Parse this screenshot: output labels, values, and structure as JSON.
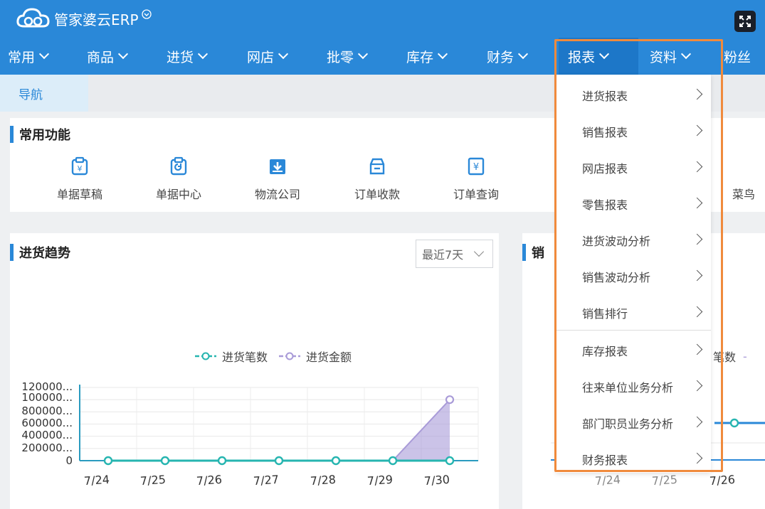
{
  "app": {
    "brand": "管家婆云ERP"
  },
  "nav": [
    {
      "label": "常用"
    },
    {
      "label": "商品"
    },
    {
      "label": "进货"
    },
    {
      "label": "网店"
    },
    {
      "label": "批零"
    },
    {
      "label": "库存"
    },
    {
      "label": "财务"
    },
    {
      "label": "报表"
    },
    {
      "label": "资料"
    },
    {
      "label": "粉丝"
    }
  ],
  "tabs": {
    "nav_tab": "导航"
  },
  "common": {
    "title": "常用功能",
    "items": [
      {
        "label": "单据草稿",
        "icon": "draft-document-icon"
      },
      {
        "label": "单据中心",
        "icon": "document-center-icon"
      },
      {
        "label": "物流公司",
        "icon": "logistics-icon"
      },
      {
        "label": "订单收款",
        "icon": "order-payment-icon"
      },
      {
        "label": "订单查询",
        "icon": "order-query-icon"
      },
      {
        "label": "菜鸟",
        "icon": "cainiao-icon"
      }
    ]
  },
  "purchase_trend": {
    "title": "进货趋势",
    "range_select": "最近7天"
  },
  "sales_panel": {
    "title_partial": "销",
    "legend_partial": "笔数"
  },
  "report_menu": {
    "items": [
      "进货报表",
      "销售报表",
      "网店报表",
      "零售报表",
      "进货波动分析",
      "销售波动分析",
      "销售排行",
      "库存报表",
      "往来单位业务分析",
      "部门职员业务分析",
      "财务报表"
    ]
  },
  "colors": {
    "primary": "#2a88d8",
    "highlight": "#f08a3c",
    "series1": "#26b5b0",
    "series2": "#a99bd8"
  },
  "chart_data": [
    {
      "type": "line",
      "categories": [
        "7/24",
        "7/25",
        "7/26",
        "7/27",
        "7/28",
        "7/29",
        "7/30"
      ],
      "series": [
        {
          "name": "进货笔数",
          "values": [
            0,
            0,
            0,
            0,
            0,
            0,
            0
          ]
        },
        {
          "name": "进货金额",
          "values": [
            0,
            0,
            0,
            0,
            0,
            0,
            1000000
          ]
        }
      ],
      "y_ticks": [
        "120000...",
        "100000...",
        "800000...",
        "600000...",
        "400000...",
        "200000...",
        "0"
      ],
      "ylim": [
        0,
        1200000
      ],
      "legend": "top-center",
      "grid": true
    },
    {
      "type": "line",
      "categories": [
        "7/24",
        "7/25",
        "7/26"
      ],
      "partial": true
    }
  ]
}
